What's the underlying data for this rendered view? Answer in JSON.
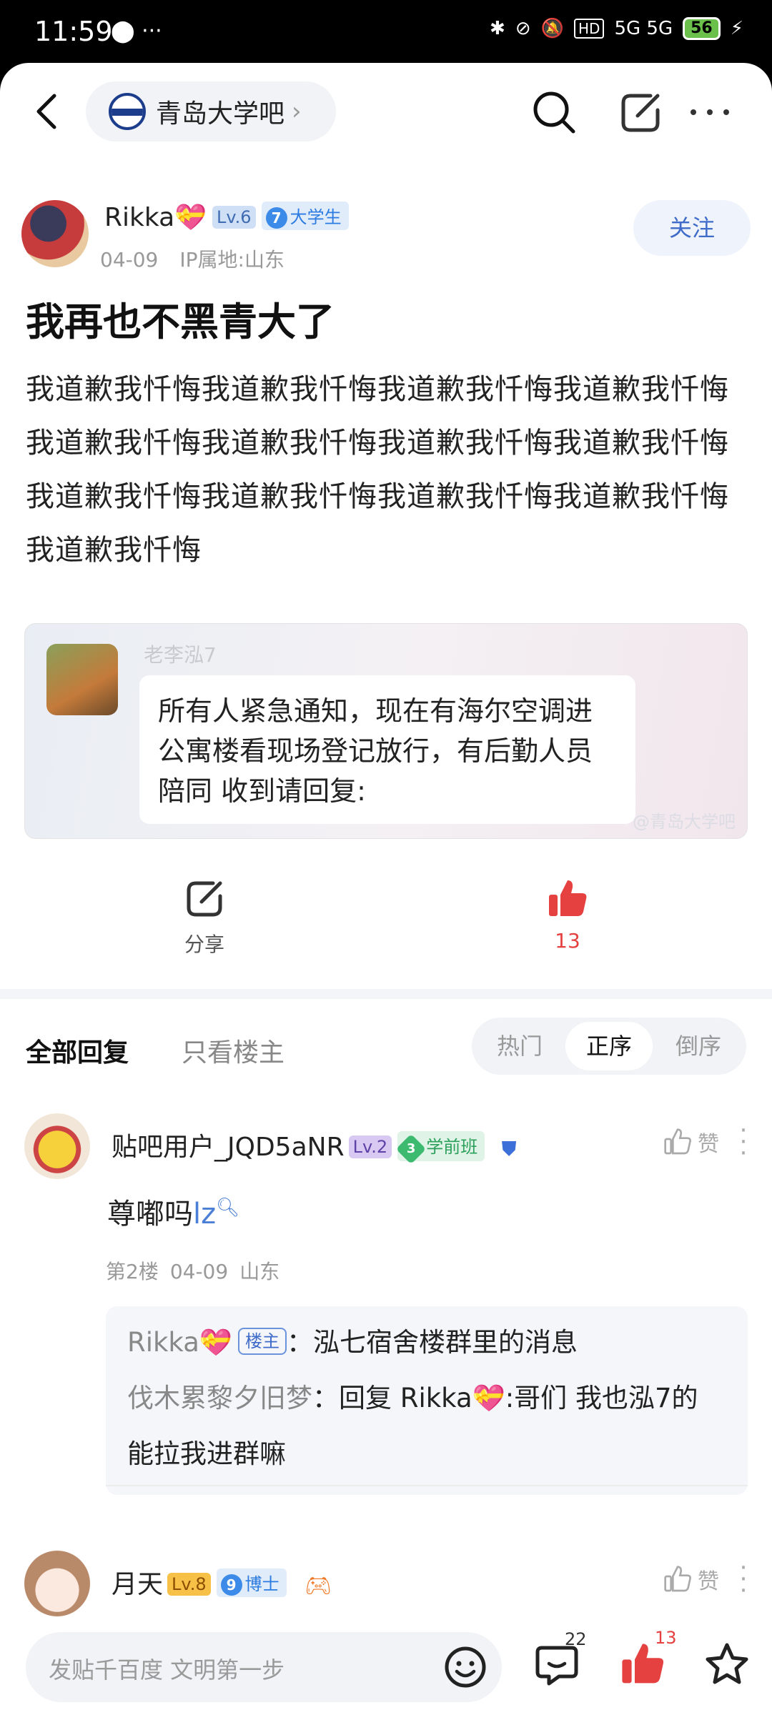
{
  "status_bar": {
    "time": "11:59",
    "left_icons": "⬤ ···",
    "signal": "5G 5G",
    "hd_label": "HD",
    "battery": "56"
  },
  "topbar": {
    "forum_name": "青岛大学吧",
    "forum_chevron": "›"
  },
  "post": {
    "author": "Rikka",
    "author_heart": "💝",
    "level": "Lv.6",
    "title_level": "7",
    "title_name": "大学生",
    "date": "04-09",
    "ip": "IP属地:山东",
    "follow_label": "关注",
    "title": "我再也不黑青大了",
    "body": "我道歉我忏悔我道歉我忏悔我道歉我忏悔我道歉我忏悔我道歉我忏悔我道歉我忏悔我道歉我忏悔我道歉我忏悔我道歉我忏悔我道歉我忏悔我道歉我忏悔我道歉我忏悔我道歉我忏悔"
  },
  "quote": {
    "name": "老李泓7",
    "text": "所有人紧急通知，现在有海尔空调进公寓楼看现场登记放行，有后勤人员陪同  收到请回复:",
    "watermark": "@青岛大学吧"
  },
  "actions": {
    "share_label": "分享",
    "like_count": "13"
  },
  "reply_tabs": {
    "all": "全部回复",
    "lz_only": "只看楼主",
    "sort": [
      "热门",
      "正序",
      "倒序"
    ],
    "active_sort": "正序"
  },
  "comments": [
    {
      "name": "贴吧用户_JQD5aNR",
      "level": "Lv.2",
      "title_level": "3",
      "title_name": "学前班",
      "like_label": "赞",
      "text": "尊嘟吗",
      "text_link": "lz",
      "floor": "第2楼",
      "date": "04-09",
      "location": "山东",
      "sub_replies": {
        "line1_user": "Rikka",
        "line1_heart": "💝",
        "line1_tag": "楼主",
        "line1_text": "：泓七宿舍楼群里的消息",
        "line2_user": "伐木累黎夕旧梦",
        "line2_prefix": "：回复 Rikka",
        "line2_heart": "💝",
        "line2_text": ":哥们 我也泓7的 能拉我进群嘛"
      }
    },
    {
      "name": "月天",
      "level": "Lv.8",
      "title_level": "9",
      "title_name": "博士",
      "like_label": "赞"
    }
  ],
  "bottom_bar": {
    "placeholder": "发贴千百度 文明第一步",
    "comment_count": "22",
    "like_count": "13"
  },
  "colors": {
    "accent_blue": "#3f6bc9",
    "like_red": "#e54141"
  }
}
